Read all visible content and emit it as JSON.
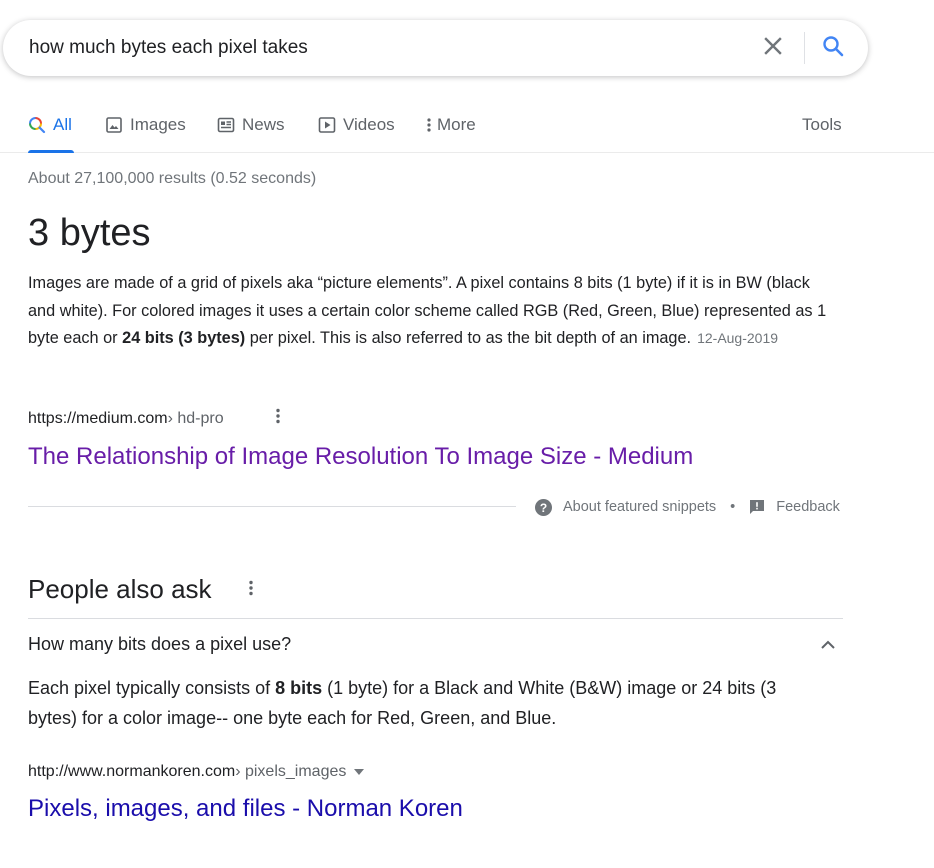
{
  "search": {
    "query": "how much bytes each pixel takes",
    "clear_icon": "close-icon",
    "search_icon": "search-icon"
  },
  "tabs": [
    {
      "label": "All",
      "icon": "search-icon",
      "active": true
    },
    {
      "label": "Images",
      "icon": "image-icon"
    },
    {
      "label": "News",
      "icon": "news-icon"
    },
    {
      "label": "Videos",
      "icon": "play-icon"
    },
    {
      "label": "More",
      "icon": "dots-vertical-icon"
    }
  ],
  "tools_label": "Tools",
  "stats": "About 27,100,000 results (0.52 seconds)",
  "featured": {
    "answer": "3 bytes",
    "snippet_part1": "Images are made of a grid of pixels aka “picture elements”. A pixel contains 8 bits (1 byte) if it is in BW (black and white). For colored images it uses a certain color scheme called RGB (Red, Green, Blue) represented as 1 byte each or ",
    "snippet_bold": "24 bits (3 bytes)",
    "snippet_part2": " per pixel. This is also referred to as the bit depth of an image.",
    "date": "12-Aug-2019",
    "cite_domain": "https://medium.com",
    "cite_path": " › hd-pro",
    "title": "The Relationship of Image Resolution To Image Size - Medium",
    "about_label": "About featured snippets",
    "separator": "•",
    "feedback_label": "Feedback"
  },
  "paa": {
    "title": "People also ask",
    "question": "How many bits does a pixel use?",
    "answer_part1": "Each pixel typically consists of ",
    "answer_bold": "8 bits",
    "answer_part2": " (1 byte) for a Black and White (B&W) image or 24 bits (3 bytes) for a color image-- one byte each for Red, Green, and Blue.",
    "cite_domain": "http://www.normankoren.com",
    "cite_path": " › pixels_images",
    "result_title": "Pixels, images, and files - Norman Koren"
  },
  "colors": {
    "accent": "#1a73e8",
    "visited_link": "#681da8",
    "link": "#1a0dab",
    "secondary_text": "#70757a"
  }
}
